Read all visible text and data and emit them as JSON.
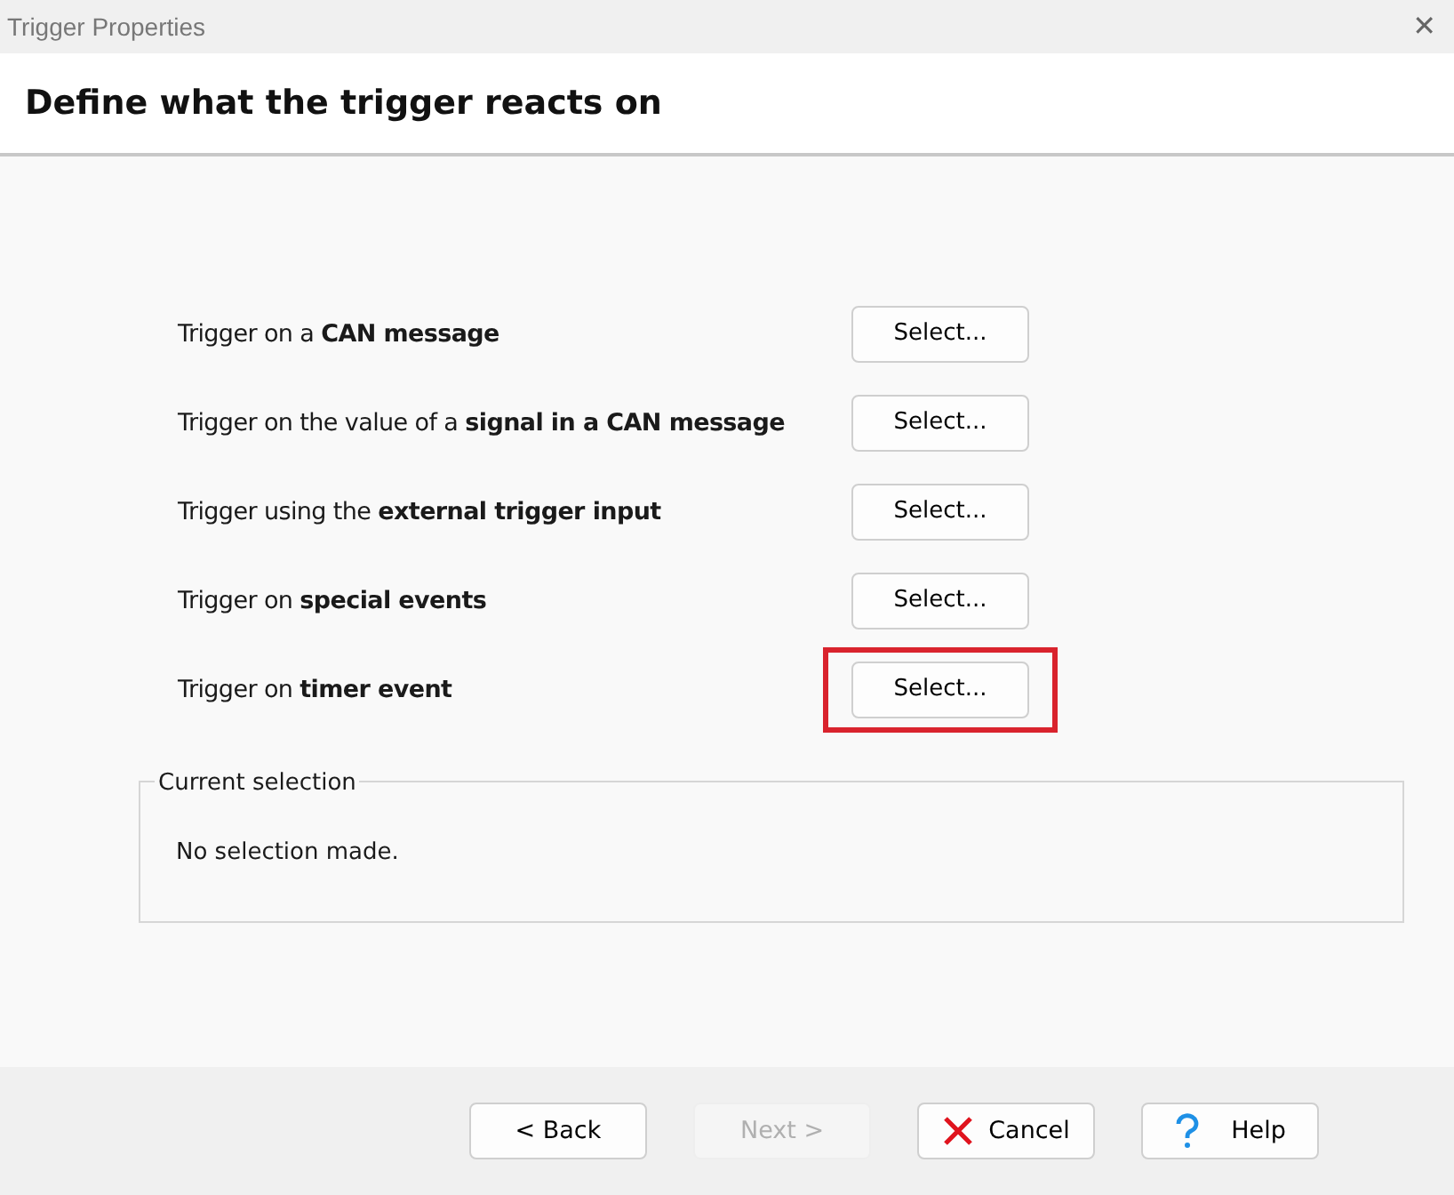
{
  "window": {
    "title": "Trigger Properties",
    "close": "✕"
  },
  "header": {
    "title": "Define what the trigger reacts on"
  },
  "options": [
    {
      "label": "Trigger on a **CAN message**",
      "button": "Select...",
      "highlighted": false
    },
    {
      "label": "Trigger on the value of a **signal in a CAN message**",
      "button": "Select...",
      "highlighted": false
    },
    {
      "label": "Trigger using the **external trigger input**",
      "button": "Select...",
      "highlighted": false
    },
    {
      "label": "Trigger on **special events**",
      "button": "Select...",
      "highlighted": false
    },
    {
      "label": "Trigger on **timer event**",
      "button": "Select...",
      "highlighted": true
    }
  ],
  "current_selection": {
    "legend": "Current selection",
    "text": "No selection made."
  },
  "buttons": [
    {
      "label": "< Back",
      "kind": "plain",
      "disabled": false
    },
    {
      "label": "Next >",
      "kind": "plain",
      "disabled": true
    },
    {
      "label": "Cancel",
      "kind": "cancel",
      "disabled": false
    },
    {
      "label": "Help",
      "kind": "help",
      "disabled": false
    }
  ]
}
